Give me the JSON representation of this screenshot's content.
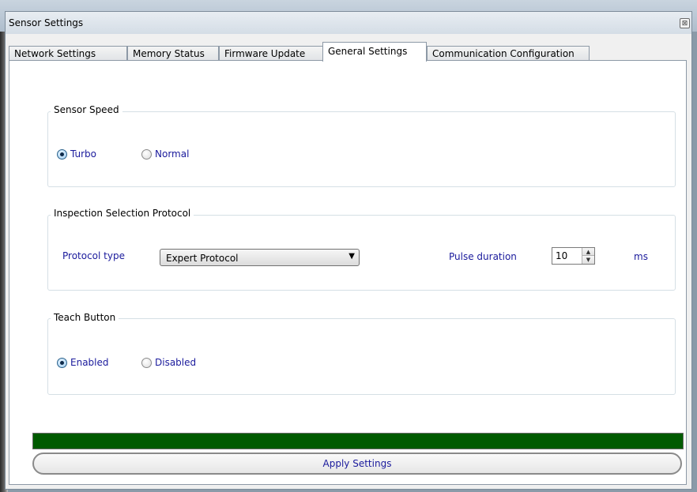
{
  "window": {
    "title": "Sensor Settings",
    "close_glyph": "⊠"
  },
  "tabs": [
    {
      "label": "Network Settings",
      "active": false
    },
    {
      "label": "Memory Status",
      "active": false
    },
    {
      "label": "Firmware Update",
      "active": false
    },
    {
      "label": "General Settings",
      "active": true
    },
    {
      "label": "Communication Configuration",
      "active": false
    }
  ],
  "sensor_speed": {
    "title": "Sensor Speed",
    "options": [
      {
        "label": "Turbo",
        "checked": true
      },
      {
        "label": "Normal",
        "checked": false
      }
    ]
  },
  "protocol": {
    "title": "Inspection Selection Protocol",
    "type_label": "Protocol type",
    "type_value": "Expert Protocol",
    "pulse_label": "Pulse duration",
    "pulse_value": "10",
    "pulse_unit": "ms"
  },
  "teach_button": {
    "title": "Teach Button",
    "options": [
      {
        "label": "Enabled",
        "checked": true
      },
      {
        "label": "Disabled",
        "checked": false
      }
    ]
  },
  "progress": {
    "fraction": 1.0,
    "color": "#005a00"
  },
  "apply_label": "Apply Settings"
}
